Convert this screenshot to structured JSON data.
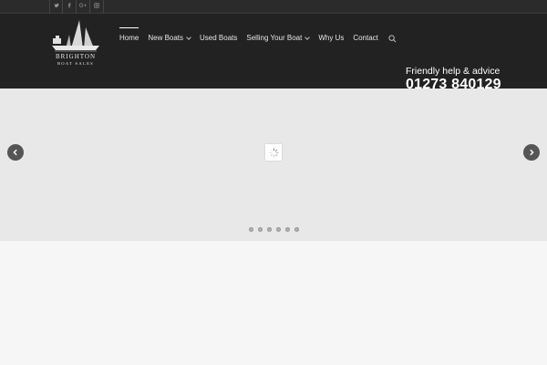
{
  "social": [
    {
      "name": "twitter",
      "icon": "twitter-icon"
    },
    {
      "name": "facebook",
      "icon": "facebook-icon"
    },
    {
      "name": "google-plus",
      "icon": "google-plus-icon",
      "label": "G+"
    },
    {
      "name": "instagram",
      "icon": "instagram-icon"
    }
  ],
  "logo": {
    "line1": "BRIGHTON",
    "line2": "BOAT SALES"
  },
  "nav": {
    "items": [
      {
        "label": "Home",
        "active": true,
        "dropdown": false
      },
      {
        "label": "New Boats",
        "active": false,
        "dropdown": true
      },
      {
        "label": "Used Boats",
        "active": false,
        "dropdown": false
      },
      {
        "label": "Selling Your Boat",
        "active": false,
        "dropdown": true
      },
      {
        "label": "Why Us",
        "active": false,
        "dropdown": false
      },
      {
        "label": "Contact",
        "active": false,
        "dropdown": false
      }
    ],
    "search_icon": "search-icon"
  },
  "contact": {
    "tagline": "Friendly help & advice",
    "phone": "01273 840129"
  },
  "slider": {
    "prev_icon": "chevron-left-icon",
    "next_icon": "chevron-right-icon",
    "loader_icon": "spinner-icon",
    "slide_count": 6
  },
  "colors": {
    "topbar": "#2b2b2b",
    "header": "#222222",
    "slider_bg": "#e8e8e8",
    "page_bg": "#f6f6f6"
  }
}
